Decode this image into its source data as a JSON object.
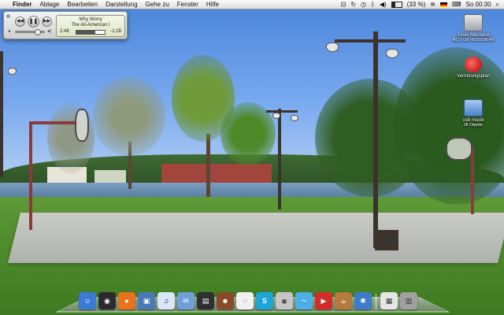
{
  "menubar": {
    "apple": "",
    "items": [
      "Finder",
      "Ablage",
      "Bearbeiten",
      "Darstellung",
      "Gehe zu",
      "Fenster",
      "Hilfe"
    ],
    "status": {
      "battery_percent": "(33 %)",
      "clock": "So 00:30"
    }
  },
  "player": {
    "title": "Why Worry",
    "artist": "The All-American I",
    "elapsed": "2:48",
    "remaining": "-1:28",
    "progress": 0.66,
    "volume": 0.7
  },
  "desktop_icons": [
    {
      "label": "Sinas Macbook",
      "sub": "48,73 GB, 43,83 GB frei",
      "icon": "hard-drive-icon"
    },
    {
      "label": "Vertretungsplan",
      "sub": "",
      "icon": "application-icon"
    },
    {
      "label": "usb musik",
      "sub": "38 Objekte",
      "icon": "usb-drive-icon"
    }
  ],
  "dock": [
    {
      "name": "finder-icon",
      "color": "#3a7bd5",
      "glyph": "☺"
    },
    {
      "name": "dashboard-icon",
      "color": "#2b2b2b",
      "glyph": "◉"
    },
    {
      "name": "firefox-icon",
      "color": "#e8731c",
      "glyph": "●"
    },
    {
      "name": "iphoto-icon",
      "color": "#4a79b8",
      "glyph": "▣"
    },
    {
      "name": "itunes-icon",
      "color": "#d8e6f5",
      "glyph": "♫"
    },
    {
      "name": "mail-icon",
      "color": "#6f9fd8",
      "glyph": "✉"
    },
    {
      "name": "photo-booth-icon",
      "color": "#2f2f2f",
      "glyph": "▤"
    },
    {
      "name": "adium-icon",
      "color": "#8a4a2a",
      "glyph": "☻"
    },
    {
      "name": "quicksilver-icon",
      "color": "#f0f0f0",
      "glyph": "◌"
    },
    {
      "name": "skype-icon",
      "color": "#1ea5d8",
      "glyph": "S"
    },
    {
      "name": "activity-icon",
      "color": "#c5c5c5",
      "glyph": "⧈"
    },
    {
      "name": "wave-icon",
      "color": "#4fb0e8",
      "glyph": "~"
    },
    {
      "name": "youtube-icon",
      "color": "#d42a2a",
      "glyph": "▶"
    },
    {
      "name": "coffee-icon",
      "color": "#b57a3c",
      "glyph": "☕"
    },
    {
      "name": "safari-icon",
      "color": "#3d7cc9",
      "glyph": "✱"
    },
    {
      "name": "preview-icon",
      "color": "#e5e5e5",
      "glyph": "▦"
    },
    {
      "name": "trash-icon",
      "color": "#a0a0a0",
      "glyph": "▥"
    }
  ]
}
